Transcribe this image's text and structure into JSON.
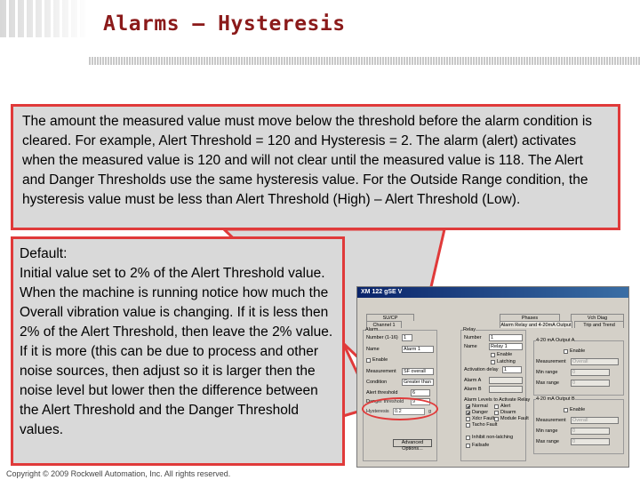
{
  "slide": {
    "title": "Alarms – Hysteresis",
    "copyright": "Copyright © 2009 Rockwell Automation, Inc. All rights reserved."
  },
  "callout_top": {
    "text": "The amount the measured value must move below the threshold before the alarm condition is cleared. For example, Alert Threshold = 120 and Hysteresis = 2. The alarm (alert) activates when the measured value is 120 and will not clear until the measured value is 118.  The Alert and Danger Thresholds use the same hysteresis value.  For the Outside Range condition, the hysteresis value must be less than Alert Threshold (High) – Alert Threshold (Low)."
  },
  "callout_left": {
    "heading": "Default:",
    "text": "Initial value set to 2% of the Alert Threshold value. When the machine is running notice how much the Overall vibration value is changing. If it is less then 2% of the Alert Threshold, then leave the 2% value. If it is more (this can be due to process and other noise sources, then adjust so it is larger then the noise level but lower then the difference between the Alert Threshold and the Danger Threshold values."
  },
  "colors": {
    "title": "#8b1a1a",
    "callout_border": "#e03a3a",
    "callout_fill": "#d9d9d9"
  },
  "dialog": {
    "title": "XM 122 gSE V",
    "tabs_top": [
      "SU/CP",
      "Phases",
      "Vch Diag"
    ],
    "tabs_row2": [
      "Channel 1",
      "Alarm Relay and 4-20mA Output",
      "Trip and Trend"
    ],
    "alarm": {
      "group": "Alarm",
      "number_label": "Number (1-16)",
      "number": "1",
      "name_label": "Name",
      "name": "Alarm 1",
      "enable_label": "Enable",
      "measurement_label": "Measurement",
      "measurement": "SF overall",
      "condition_label": "Condition",
      "condition": "Greater than",
      "alert_threshold_label": "Alert threshold",
      "alert_threshold": "6",
      "danger_threshold_label": "Danger threshold",
      "danger_threshold": "9",
      "hysteresis_label": "Hysteresis",
      "hysteresis": "0.2",
      "hysteresis_unit": "g",
      "advanced_button": "Advanced Options..."
    },
    "relay": {
      "group": "Relay",
      "number_label": "Number",
      "number": "1",
      "name_label": "Name",
      "name": "Relay 1",
      "enable_label": "Enable",
      "latching_label": "Latching",
      "activation_delay_label": "Activation delay",
      "activation_delay": "1",
      "alarm_a_label": "Alarm A",
      "alarm_b_label": "Alarm B",
      "alarm_levels_label": "Alarm Levels to Activate Relay",
      "levels": [
        {
          "label": "Normal",
          "checked": true
        },
        {
          "label": "Alert",
          "checked": false
        },
        {
          "label": "Danger",
          "checked": true
        },
        {
          "label": "Disarm",
          "checked": false
        },
        {
          "label": "Xdcr Fault",
          "checked": false
        },
        {
          "label": "Module Fault",
          "checked": false
        },
        {
          "label": "Tacho Fault",
          "checked": false
        }
      ],
      "inhibit_label": "Inhibit non-latching",
      "failsafe_label": "Failsafe"
    },
    "output_a": {
      "group": "4-20 mA Output A",
      "enable_label": "Enable",
      "measurement_label": "Measurement",
      "measurement": "Overall",
      "min_label": "Min range",
      "min": "0",
      "max_label": "Max range",
      "max": "0"
    },
    "output_b": {
      "group": "4-20 mA Output B",
      "enable_label": "Enable",
      "measurement_label": "Measurement",
      "measurement": "Overall",
      "min_label": "Min range",
      "min": "0",
      "max_label": "Max range",
      "max": "0"
    }
  }
}
